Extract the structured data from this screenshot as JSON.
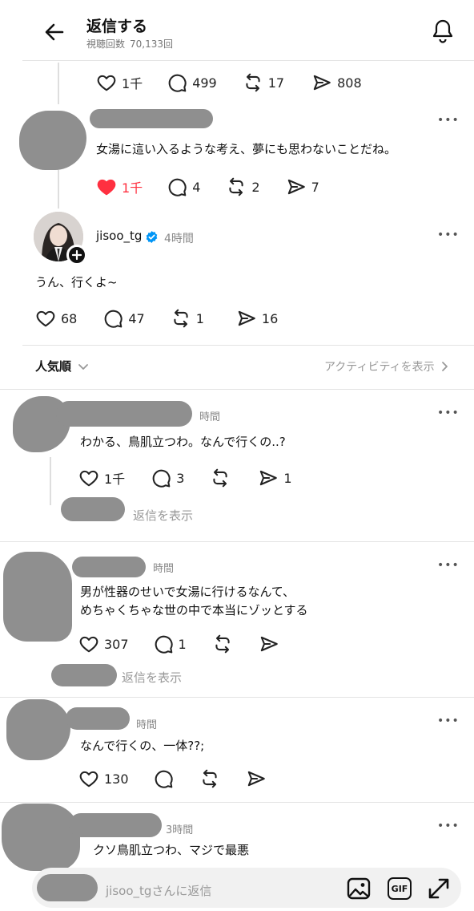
{
  "header": {
    "title": "返信する",
    "views_label": "視聴回数",
    "views_count": "70,133回"
  },
  "top_post": {
    "likes": "1千",
    "comments": "499",
    "reposts": "17",
    "shares": "808"
  },
  "reply1": {
    "text": "女湯に這い入るような考え、夢にも思わないことだね。",
    "likes": "1千",
    "comments": "4",
    "reposts": "2",
    "shares": "7",
    "liked": true
  },
  "author_post": {
    "username": "jisoo_tg",
    "time": "4時間",
    "text": "うん、行くよ~",
    "likes": "68",
    "comments": "47",
    "reposts": "1",
    "shares": "16"
  },
  "sort": {
    "label": "人気順",
    "activity_link": "アクティビティを表示"
  },
  "comments": [
    {
      "time": "時間",
      "text": "わかる、鳥肌立つわ。なんで行くの..?",
      "likes": "1千",
      "comments": "3",
      "reposts": "",
      "shares": "1",
      "show_replies": "返信を表示"
    },
    {
      "time": "時間",
      "line1": "男が性器のせいで女湯に行けるなんて、",
      "line2": "めちゃくちゃな世の中で本当にゾッとする",
      "likes": "307",
      "comments": "1",
      "reposts": "",
      "shares": "",
      "show_replies": "返信を表示"
    },
    {
      "time": "時間",
      "text": "なんで行くの、一体??;",
      "likes": "130",
      "comments": "",
      "reposts": "",
      "shares": ""
    },
    {
      "time": "3時間",
      "text": "クソ鳥肌立つわ、マジで最悪"
    }
  ],
  "reply_bar": {
    "placeholder": "jisoo_tgさんに返信",
    "gif_label": "GIF"
  },
  "colors": {
    "like_red": "#ff3040",
    "verified_blue": "#0095f6",
    "redaction_gray": "#8f8f8f"
  },
  "icons": [
    "back-arrow-icon",
    "bell-icon",
    "heart-icon",
    "comment-icon",
    "repost-icon",
    "share-icon",
    "more-icon",
    "verified-icon",
    "follow-plus-icon",
    "chevron-down-icon",
    "chevron-right-icon",
    "image-icon",
    "gif-icon",
    "expand-icon"
  ]
}
